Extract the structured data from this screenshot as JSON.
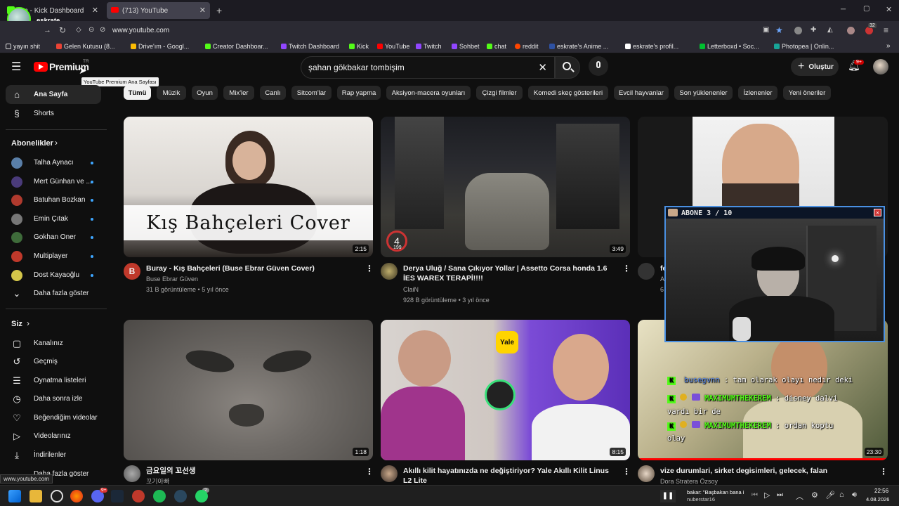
{
  "browser": {
    "tabs": [
      {
        "label": "am - Kick Dashboard",
        "close": "✕"
      },
      {
        "label": "(713) YouTube",
        "close": "✕"
      }
    ],
    "new_tab": "+",
    "window_controls": {
      "min": "─",
      "max": "▢",
      "close": "✕"
    },
    "url": "www.youtube.com",
    "profile_name": "eskrate",
    "bookmarks": [
      "yayın shit",
      "Gelen Kutusu (8...",
      "Drive'ım - Googl...",
      "Creator Dashboar...",
      "Twitch Dashboard",
      "Kick",
      "YouTube",
      "Twitch",
      "Sohbet",
      "chat",
      "reddit",
      "eskrate's Anime ...",
      "eskrate's profil...",
      "Letterboxd • Soc...",
      "Photopea | Onlin..."
    ],
    "bookmark_more": "»",
    "ext_badge": "32",
    "status_url": "www.youtube.com"
  },
  "header": {
    "logo_text": "Premium",
    "logo_region": "TR",
    "tooltip": "YouTube Premium Ana Sayfası",
    "search_value": "şahan gökbakar tombişim",
    "create_label": "Oluştur",
    "notif_badge": "9+"
  },
  "sidebar": {
    "main": [
      {
        "label": "Ana Sayfa",
        "icon": "home-icon"
      },
      {
        "label": "Shorts",
        "icon": "shorts-icon"
      }
    ],
    "subs_title": "Abonelikler",
    "subs": [
      {
        "label": "Talha Aynacı",
        "color": "#5a7fa8"
      },
      {
        "label": "Mert Günhan ve ...",
        "color": "#4a3b7a"
      },
      {
        "label": "Batuhan Bozkan",
        "color": "#b03a2e"
      },
      {
        "label": "Emin Çıtak",
        "color": "#777777"
      },
      {
        "label": "Gokhan Oner",
        "color": "#3e6b3a"
      },
      {
        "label": "Multiplayer",
        "color": "#c0392b"
      },
      {
        "label": "Dost Kayaoğlu",
        "color": "#d4c64a"
      }
    ],
    "more_label": "Daha fazla göster",
    "you_title": "Siz",
    "you": [
      {
        "label": "Kanalınız",
        "icon": "channel-icon"
      },
      {
        "label": "Geçmiş",
        "icon": "history-icon"
      },
      {
        "label": "Oynatma listeleri",
        "icon": "playlist-icon"
      },
      {
        "label": "Daha sonra izle",
        "icon": "clock-icon"
      },
      {
        "label": "Beğendiğim videolar",
        "icon": "thumb-up-icon"
      },
      {
        "label": "Videolarınız",
        "icon": "video-icon"
      },
      {
        "label": "İndirilenler",
        "icon": "download-icon"
      },
      {
        "label": "Daha fazla göster",
        "icon": "chevron-down-icon"
      }
    ]
  },
  "chips": [
    "Tümü",
    "Müzik",
    "Oyun",
    "Mix'ler",
    "Canlı",
    "Sitcom'lar",
    "Rap yapma",
    "Aksiyon-macera oyunları",
    "Çizgi filmler",
    "Komedi skeç gösterileri",
    "Evcil hayvanlar",
    "Son yüklenenler",
    "İzlenenler",
    "Yeni öneriler"
  ],
  "videos": [
    {
      "title": "Buray - Kış Bahçeleri (Buse Ebrar Güven Cover)",
      "channel": "Buse Ebrar Güven",
      "views": "31 B görüntüleme",
      "age": "5 yıl önce",
      "duration": "2:15",
      "thumb_text": "Kış Bahçeleri Cover",
      "avatar_letter": "B"
    },
    {
      "title": "Derya Uluğ / Sana Çıkıyor Yollar | Assetto Corsa honda 1.6 İES WAREX TERAPİ!!!!",
      "channel": "ClaiN",
      "views": "928 B görüntüleme",
      "age": "3 yıl önce",
      "duration": "3:49",
      "gear": "4",
      "speed": "199"
    },
    {
      "title": "fe",
      "channel": "A",
      "views": "6",
      "age": "",
      "duration": ""
    },
    {
      "title": "금요일의 꼬선생",
      "channel": "꼬기아빠",
      "views": "",
      "age": "",
      "duration": "1:18"
    },
    {
      "title": "Akıllı kilit hayatınızda ne değiştiriyor? Yale Akıllı Kilit Linus L2 Lite",
      "channel": "",
      "views": "",
      "age": "",
      "duration": "8:15",
      "badge": "Yale"
    },
    {
      "title": "vize durumlari, sirket degisimleri, gelecek, falan",
      "channel": "Dora Stratera Özsoy",
      "views": "",
      "age": "",
      "duration": "23:30"
    }
  ],
  "overlay": {
    "title": "ABONE 3 / 10",
    "chat": [
      {
        "user": "busegvnn",
        "msg": " : tam olarak olayı nedir deki",
        "color": "#5b8df0"
      },
      {
        "user": "MAXIMUMTHEKEREM",
        "msg": " : disney dalvi",
        "color": "#53fc18"
      },
      {
        "user": "",
        "msg": "vardı bir de",
        "color": "#ffffff"
      },
      {
        "user": "MAXIMUMTHEKEREM",
        "msg": " : ordan koptu",
        "color": "#53fc18"
      },
      {
        "user": "",
        "msg": "olay",
        "color": "#ffffff"
      }
    ]
  },
  "taskbar": {
    "media_title": "bakar: \"Başbakan bana i",
    "media_artist": "nuberstar16",
    "time": "22:56",
    "date": "4.08.2026",
    "badges": {
      "discord": "9+",
      "steam_chat": "2"
    }
  }
}
